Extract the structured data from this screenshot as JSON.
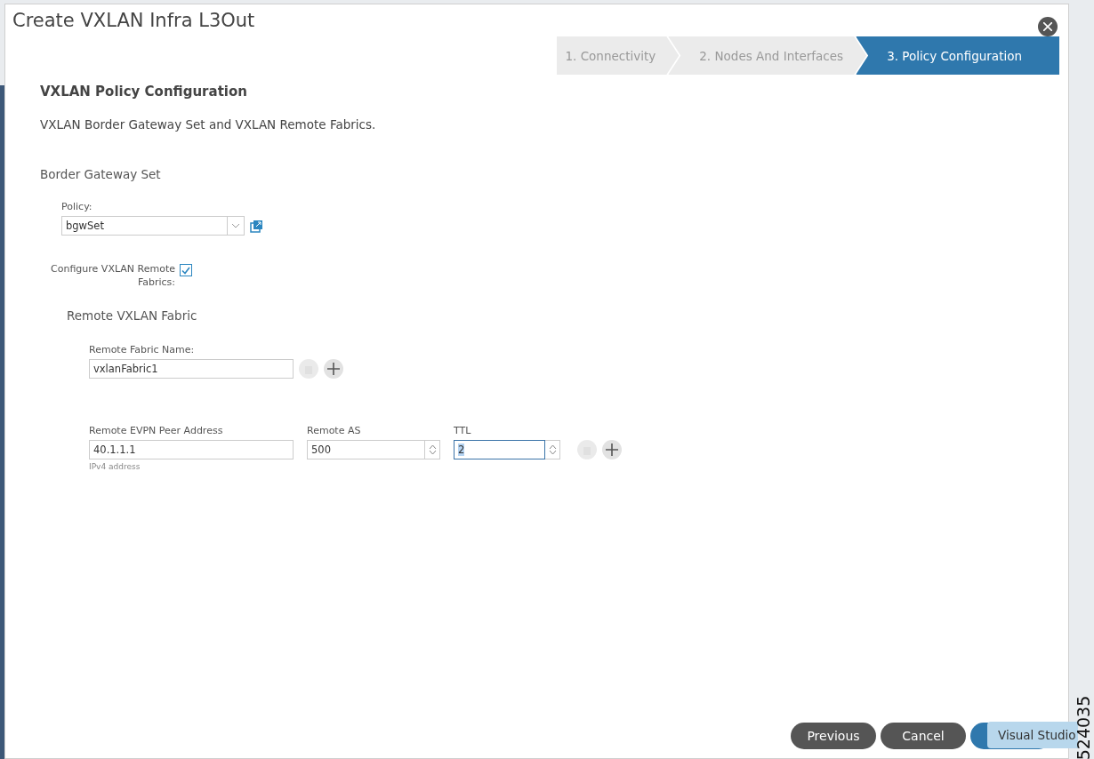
{
  "dialog": {
    "title": "Create VXLAN Infra L3Out"
  },
  "steps": [
    {
      "label": "1. Connectivity",
      "selected": false
    },
    {
      "label": "2. Nodes And Interfaces",
      "selected": false
    },
    {
      "label": "3. Policy Configuration",
      "selected": true
    }
  ],
  "section": {
    "title": "VXLAN Policy Configuration",
    "description": "VXLAN Border Gateway Set and VXLAN Remote Fabrics."
  },
  "border_gateway_set": {
    "heading": "Border Gateway Set",
    "policy_label": "Policy:",
    "policy_value": "bgwSet"
  },
  "configure_remote": {
    "label": "Configure VXLAN Remote Fabrics:",
    "checked": true
  },
  "remote_fabric": {
    "heading": "Remote VXLAN Fabric",
    "name_label": "Remote Fabric Name:",
    "name_value": "vxlanFabric1",
    "peer_label": "Remote EVPN Peer Address",
    "peer_value": "40.1.1.1",
    "peer_hint": "IPv4 address",
    "as_label": "Remote AS",
    "as_value": "500",
    "ttl_label": "TTL",
    "ttl_value": "2"
  },
  "buttons": [
    {
      "label": "Previous",
      "kind": "secondary"
    },
    {
      "label": "Cancel",
      "kind": "secondary"
    },
    {
      "kind": "primary"
    }
  ],
  "tooltip": "Visual Studio",
  "figure_id": "524035"
}
